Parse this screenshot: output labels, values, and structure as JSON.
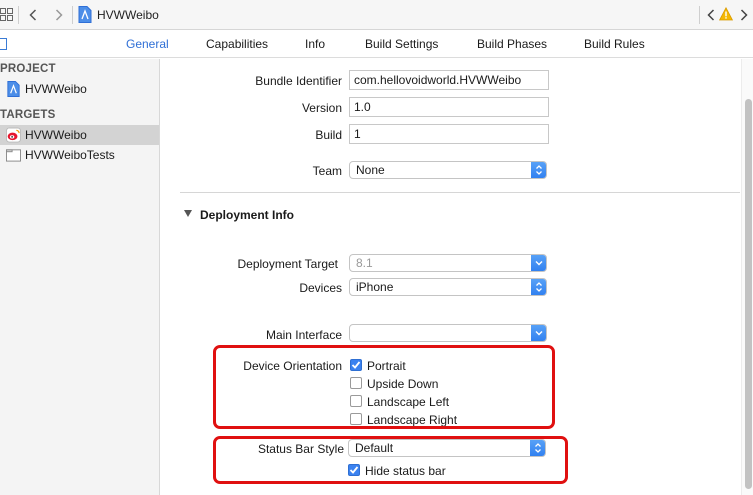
{
  "pathbar": {
    "breadcrumb": "HVWWeibo"
  },
  "tabs": [
    {
      "label": "General",
      "active": true
    },
    {
      "label": "Capabilities",
      "active": false
    },
    {
      "label": "Info",
      "active": false
    },
    {
      "label": "Build Settings",
      "active": false
    },
    {
      "label": "Build Phases",
      "active": false
    },
    {
      "label": "Build Rules",
      "active": false
    }
  ],
  "sidebar": {
    "project_header": "PROJECT",
    "project_item": "HVWWeibo",
    "targets_header": "TARGETS",
    "targets": [
      {
        "label": "HVWWeibo",
        "selected": true
      },
      {
        "label": "HVWWeiboTests",
        "selected": false
      }
    ]
  },
  "identity": {
    "bundle_identifier_label": "Bundle Identifier",
    "bundle_identifier_value": "com.hellovoidworld.HVWWeibo",
    "version_label": "Version",
    "version_value": "1.0",
    "build_label": "Build",
    "build_value": "1",
    "team_label": "Team",
    "team_value": "None"
  },
  "deployment": {
    "section_title": "Deployment Info",
    "target_label": "Deployment Target",
    "target_value": "8.1",
    "devices_label": "Devices",
    "devices_value": "iPhone",
    "main_interface_label": "Main Interface",
    "main_interface_value": "",
    "orientation_label": "Device Orientation",
    "orientations": [
      {
        "label": "Portrait",
        "checked": true
      },
      {
        "label": "Upside Down",
        "checked": false
      },
      {
        "label": "Landscape Left",
        "checked": false
      },
      {
        "label": "Landscape Right",
        "checked": false
      }
    ],
    "status_bar_label": "Status Bar Style",
    "status_bar_value": "Default",
    "hide_status_bar_label": "Hide status bar",
    "hide_status_bar_checked": true
  },
  "colors": {
    "accent": "#2f6fd6",
    "highlight": "#e01010",
    "checkbox_on": "#3b82f0"
  }
}
